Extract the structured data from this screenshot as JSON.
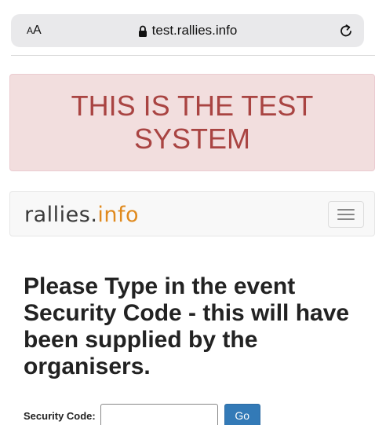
{
  "browser": {
    "text_size_label_large": "A",
    "text_size_label_small": "A",
    "url": "test.rallies.info",
    "lock_icon": "lock-icon",
    "reload_icon": "reload-icon"
  },
  "banner": {
    "text": "THIS IS THE TEST SYSTEM",
    "color": "#a94442",
    "background": "#f2dede"
  },
  "navbar": {
    "brand_part1": "rallies.",
    "brand_part2": "info",
    "menu_icon": "hamburger-icon"
  },
  "main": {
    "prompt": "Please Type in the event Security Code - this will have been supplied by the organisers.",
    "form": {
      "label": "Security Code:",
      "input_value": "",
      "submit_label": "Go",
      "submit_color": "#337ab7"
    }
  }
}
